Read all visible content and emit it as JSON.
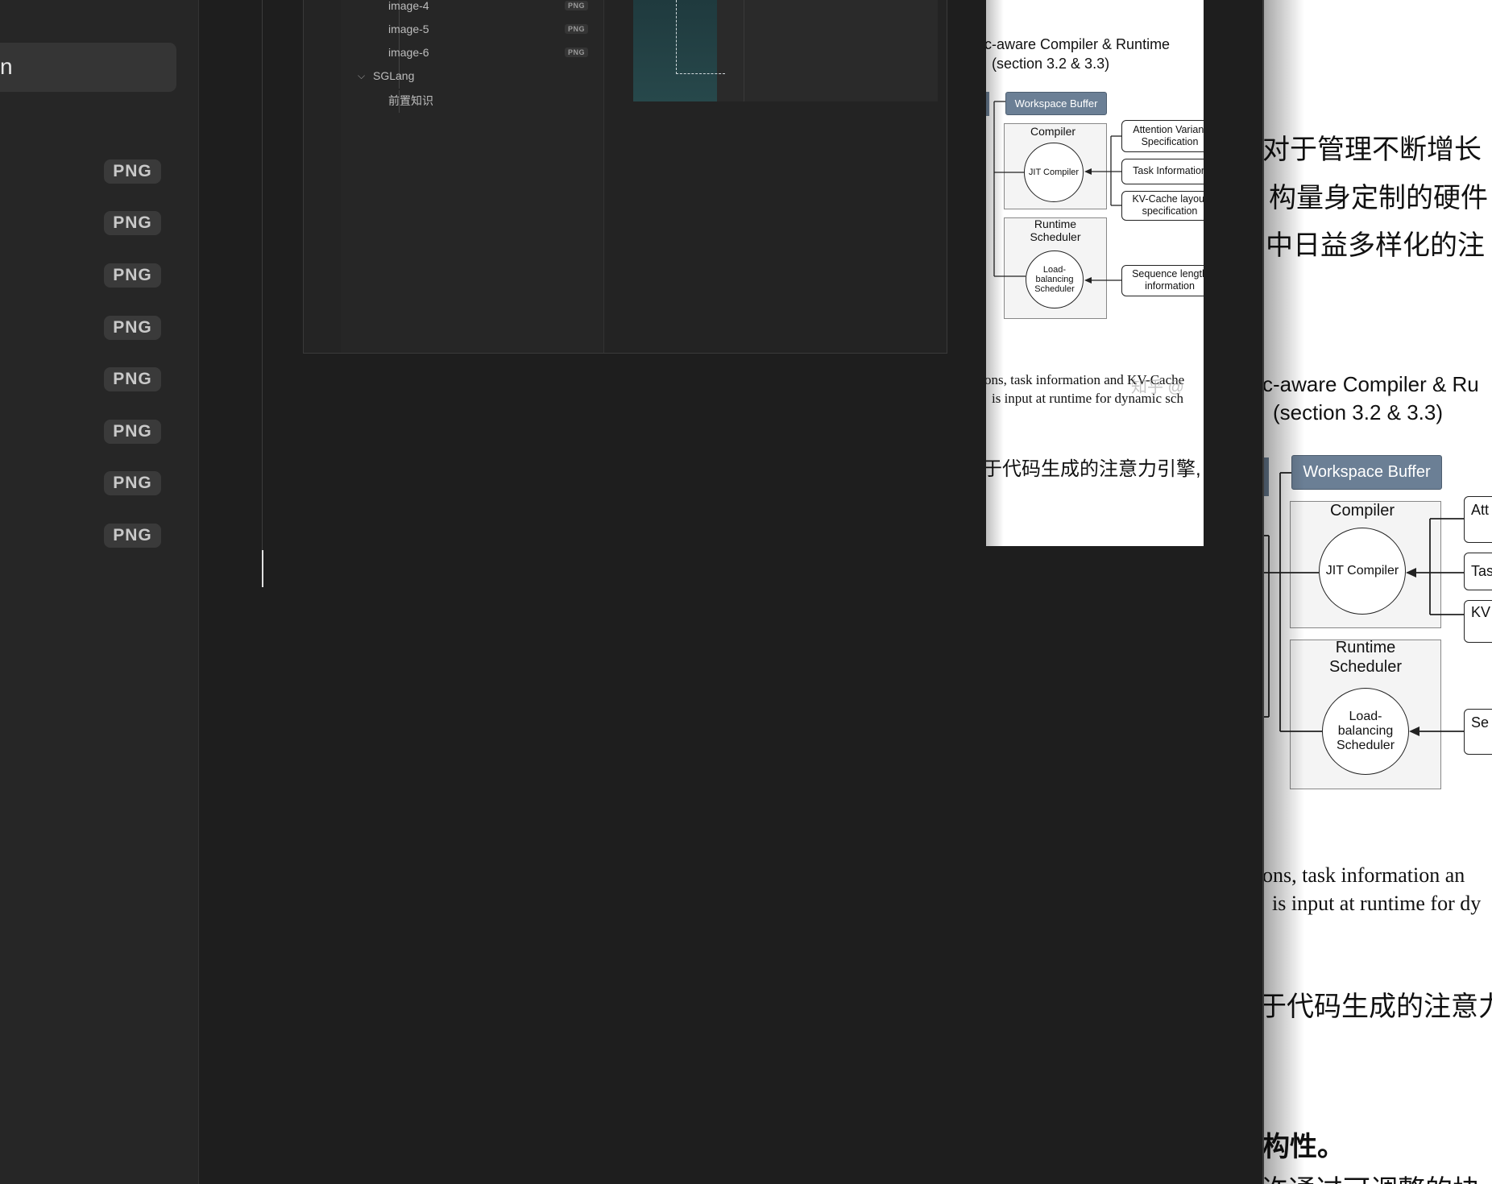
{
  "sidebar": {
    "selected_label": "n",
    "badges": [
      "PNG",
      "PNG",
      "PNG",
      "PNG",
      "PNG",
      "PNG",
      "PNG",
      "PNG"
    ]
  },
  "file_tree": {
    "items": [
      {
        "label": "image-4",
        "badge": "PNG"
      },
      {
        "label": "image-5",
        "badge": "PNG"
      },
      {
        "label": "image-6",
        "badge": "PNG"
      }
    ],
    "folder": {
      "label": "SGLang",
      "child": "前置知识"
    }
  },
  "thumb": {
    "title_line1": "c-aware Compiler & Runtime",
    "title_line2": "(section 3.2 & 3.3)",
    "workspace_buffer": "Workspace Buffer",
    "compiler": "Compiler",
    "jit_compiler": "JIT Compiler",
    "runtime_scheduler": "Runtime Scheduler",
    "lb_scheduler": "Load-balancing Scheduler",
    "spec1": "Attention Variant Specification",
    "spec2": "Task Information",
    "spec3": "KV-Cache layout specification",
    "spec4": "Sequence length information",
    "caption1": "ons, task information and KV-Cache",
    "caption2": "is input at runtime for dynamic sch",
    "watermark": "知乎 @",
    "cn_line": "于代码生成的注意力引擎,"
  },
  "doc": {
    "cn1": "对于管理不断增长",
    "cn2": "构量身定制的硬件",
    "cn3": "中日益多样化的注",
    "title_line1": "c-aware Compiler & Ru",
    "title_line2": "(section 3.2 & 3.3)",
    "workspace_buffer": "Workspace Buffer",
    "compiler": "Compiler",
    "jit_compiler": "JIT Compiler",
    "runtime_scheduler": "Runtime Scheduler",
    "lb_scheduler": "Load-balancing Scheduler",
    "spec1": "Att S",
    "spec2": "Tas",
    "spec3": "KV s",
    "spec4": "Se",
    "caption1": "ons, task information an",
    "caption2": "is input at runtime for dy",
    "cn_line": "于代码生成的注意力",
    "cn4": "构性。",
    "cn5": "许通过可调整的块"
  }
}
